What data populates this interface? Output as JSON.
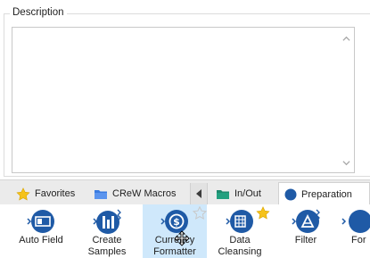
{
  "description": {
    "legend": "Description",
    "value": ""
  },
  "tabs": [
    {
      "label": "Favorites",
      "icon": "star-icon"
    },
    {
      "label": "CReW Macros",
      "icon": "folder-blue-icon"
    },
    {
      "label": "In/Out",
      "icon": "folder-green-icon"
    },
    {
      "label": "Preparation",
      "icon": "circle-blue-icon",
      "active": true
    }
  ],
  "tools": [
    {
      "label": "Auto Field",
      "icon": "auto-field-icon"
    },
    {
      "label": "Create\nSamples",
      "icon": "create-samples-icon"
    },
    {
      "label": "Currency\nFormatter",
      "icon": "currency-formatter-icon",
      "hovered": true
    },
    {
      "label": "Data\nCleansing",
      "icon": "data-cleansing-icon",
      "favorite": true
    },
    {
      "label": "Filter",
      "icon": "filter-icon"
    },
    {
      "label": "For",
      "icon": "formula-icon"
    }
  ],
  "colors": {
    "tool_blue": "#1f5aa6",
    "star_gold": "#f5c21a",
    "hover_bg": "#cfe8fb",
    "folder_green": "#1e8a6e",
    "folder_blue": "#3a7be0"
  }
}
